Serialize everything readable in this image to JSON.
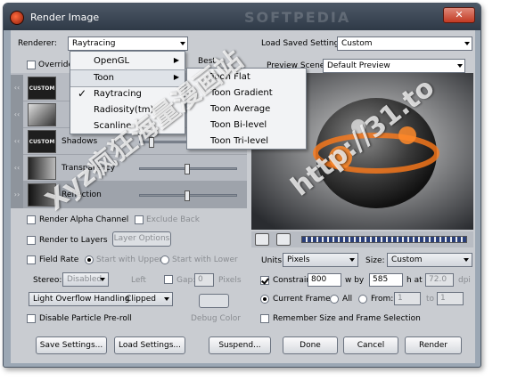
{
  "window": {
    "title": "Render Image",
    "close_label": "✕",
    "watermark": "SOFTPEDIA"
  },
  "renderer": {
    "label": "Renderer:",
    "value": "Raytracing"
  },
  "override": {
    "label": "Override",
    "checked": false
  },
  "best_label": "Best",
  "load_saved": {
    "label": "Load Saved Settings:",
    "value": "Custom"
  },
  "preview_scene": {
    "label": "Preview Scene:",
    "value": "Default Preview"
  },
  "renderer_menu": {
    "items": [
      {
        "label": "OpenGL",
        "submenu": true,
        "checked": false
      },
      {
        "label": "Toon",
        "submenu": true,
        "checked": false,
        "highlighted": true
      },
      {
        "label": "Raytracing",
        "submenu": false,
        "checked": true
      },
      {
        "label": "Radiosity(tm)",
        "submenu": false,
        "checked": false
      },
      {
        "label": "Scanline",
        "submenu": false,
        "checked": false
      }
    ],
    "check_glyph": "✓",
    "arrow_glyph": "▶"
  },
  "toon_menu": {
    "items": [
      "Toon Flat",
      "Toon Gradient",
      "Toon Average",
      "Toon Bi-level",
      "Toon Tri-level"
    ]
  },
  "effects": [
    {
      "thumb": "CUSTOM",
      "label": ""
    },
    {
      "thumb": "",
      "label": ""
    },
    {
      "thumb": "CUSTOM",
      "label": "Shadows"
    },
    {
      "thumb": "",
      "label": "Transparency"
    },
    {
      "thumb": "",
      "label": "Reflection"
    }
  ],
  "options": {
    "render_alpha": "Render Alpha Channel",
    "exclude_back": "Exclude Back",
    "render_layers": "Render to Layers",
    "layer_options": "Layer Options",
    "field_rate": "Field Rate",
    "start_with_upper": "Start with Upper",
    "start_with_lower": "Start with Lower",
    "stereo_label": "Stereo:",
    "stereo_value": "Disabled",
    "left_label": "Left",
    "gap_label": "Gap:",
    "gap_value": "0",
    "pixels_label": "Pixels",
    "light_overflow_label": "Light Overflow Handling",
    "light_overflow_value": "Clipped",
    "disable_particle": "Disable Particle Pre-roll",
    "debug_color": "Debug Color"
  },
  "size": {
    "units_label": "Units:",
    "units_value": "Pixels",
    "size_label": "Size:",
    "size_value": "Custom",
    "constrain_label": "Constrain:",
    "width": "800",
    "by_label": "w  by",
    "height": "585",
    "h_at_label": "h  at",
    "dpi": "72.0",
    "dpi_label": "dpi",
    "current_frame": "Current Frame",
    "all": "All",
    "from_label": "From:",
    "from": "1",
    "to_label": "to",
    "to": "1",
    "remember": "Remember Size and Frame Selection"
  },
  "buttons": {
    "save": "Save Settings...",
    "load": "Load Settings...",
    "suspend": "Suspend...",
    "done": "Done",
    "cancel": "Cancel",
    "render": "Render"
  },
  "overlay": {
    "text1": "Xyz疯狂海量漫画站",
    "text2": "http://31.to"
  }
}
